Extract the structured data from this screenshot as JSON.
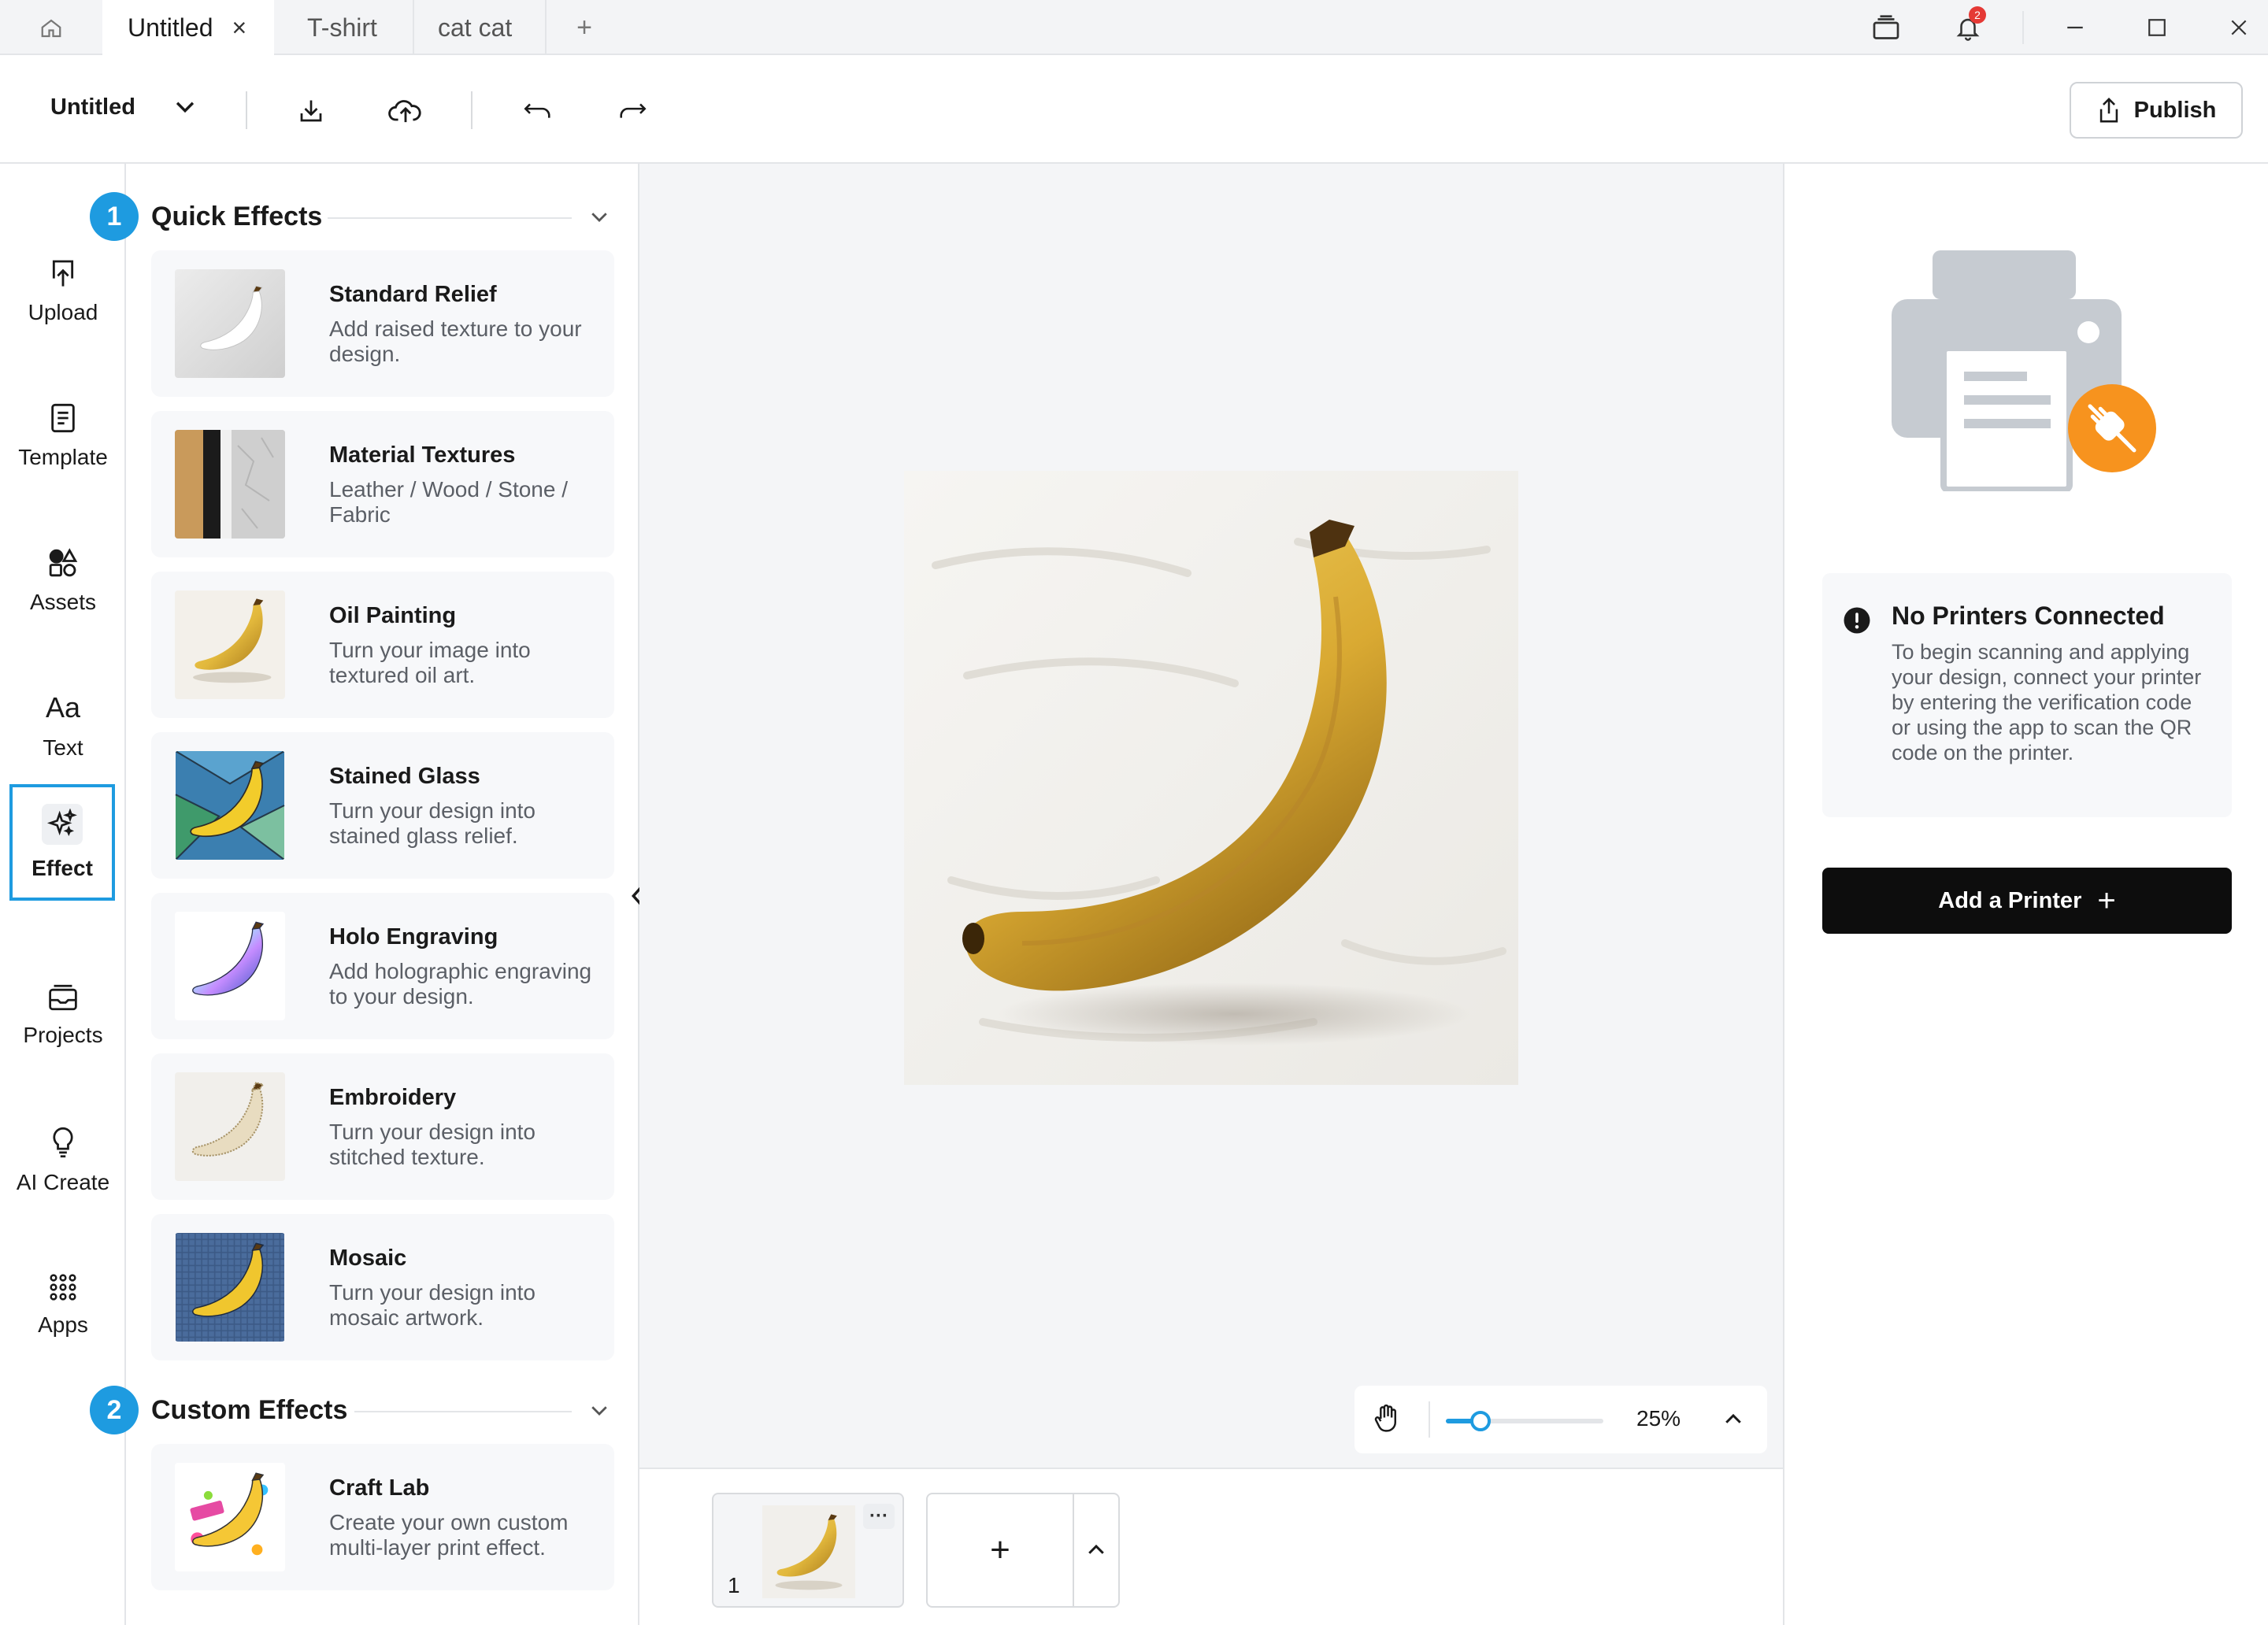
{
  "tabs": [
    {
      "label": "Untitled",
      "active": true
    },
    {
      "label": "T-shirt",
      "active": false
    },
    {
      "label": "cat cat",
      "active": false
    }
  ],
  "tab_close_glyph": "×",
  "tab_add_glyph": "+",
  "notifications_count": "2",
  "toolbar": {
    "doc_title": "Untitled",
    "publish_label": "Publish"
  },
  "rail": [
    {
      "label": "Upload",
      "icon": "upload-icon"
    },
    {
      "label": "Template",
      "icon": "template-icon"
    },
    {
      "label": "Assets",
      "icon": "assets-icon"
    },
    {
      "label": "Text",
      "icon": "text-icon",
      "glyph": "Aa"
    },
    {
      "label": "Effect",
      "icon": "sparkle-icon",
      "active": true
    },
    {
      "label": "Projects",
      "icon": "projects-icon"
    },
    {
      "label": "AI Create",
      "icon": "lightbulb-icon"
    },
    {
      "label": "Apps",
      "icon": "apps-grid-icon"
    }
  ],
  "sections": {
    "quick": {
      "step": "1",
      "title": "Quick Effects"
    },
    "custom": {
      "step": "2",
      "title": "Custom Effects"
    }
  },
  "quick_effects": [
    {
      "title": "Standard Relief",
      "desc": "Add raised texture to your design."
    },
    {
      "title": "Material Textures",
      "desc": "Leather / Wood / Stone / Fabric"
    },
    {
      "title": "Oil Painting",
      "desc": "Turn your image into textured oil art."
    },
    {
      "title": "Stained Glass",
      "desc": "Turn your design into stained glass relief."
    },
    {
      "title": "Holo Engraving",
      "desc": "Add holographic engraving to your design."
    },
    {
      "title": "Embroidery",
      "desc": "Turn your design into stitched texture."
    },
    {
      "title": "Mosaic",
      "desc": "Turn your design into mosaic artwork."
    }
  ],
  "custom_effects": [
    {
      "title": "Craft Lab",
      "desc": "Create your own custom multi-layer print effect."
    }
  ],
  "zoom": {
    "value_label": "25%",
    "fraction": 0.22
  },
  "pages": [
    {
      "number": "1",
      "more_glyph": "···"
    }
  ],
  "add_page_glyph": "+",
  "printer": {
    "title": "No Printers Connected",
    "message": "To begin scanning and applying your design, connect your printer by entering the verification code or using the app to scan the QR code on the printer.",
    "button_label": "Add a Printer",
    "button_glyph": "+"
  },
  "colors": {
    "accent": "#1e9be0",
    "plug_badge": "#f7931e",
    "banana": "#e2b83c",
    "button_dark": "#0d0d0d"
  }
}
